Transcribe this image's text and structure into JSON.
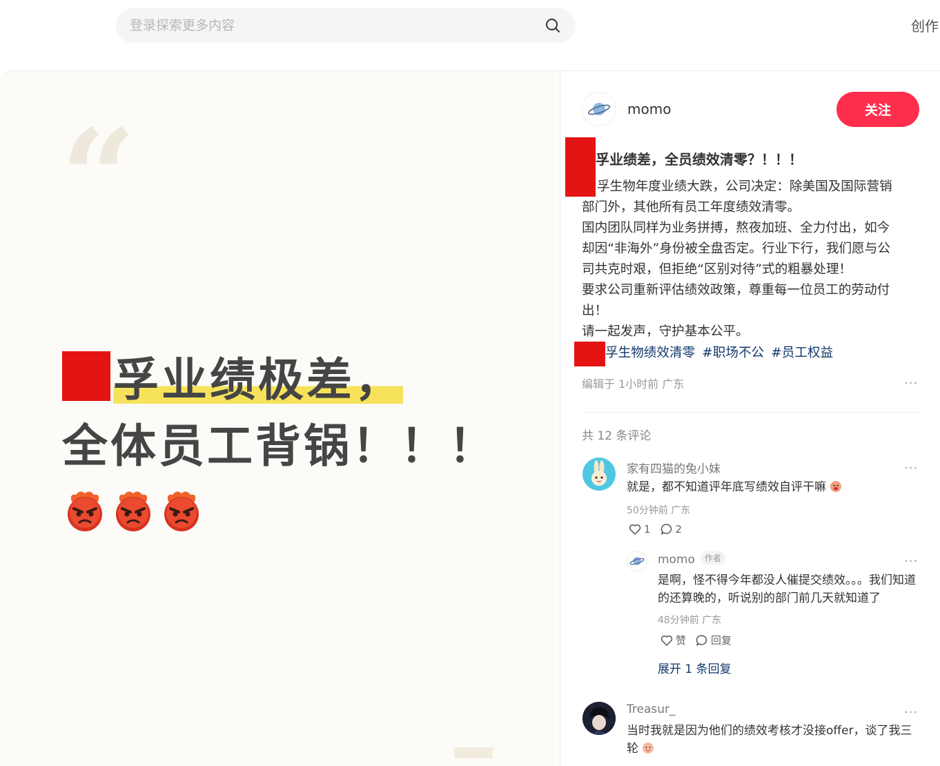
{
  "search": {
    "placeholder": "登录探索更多内容"
  },
  "header": {
    "create_label": "创作"
  },
  "media": {
    "headline_line1_rest": "孚业绩极差，",
    "headline_line2": "全体员工背锅！！！"
  },
  "author": {
    "name": "momo",
    "follow_label": "关注"
  },
  "post": {
    "title": "孚业绩差，全员绩效清零？！！！",
    "body_first": "孚生物年度业绩大跌，公司决定：除美国及国际营销",
    "body_lines": [
      "部门外，其他所有员工年度绩效清零。",
      "国内团队同样为业务拼搏，熬夜加班、全力付出，如今",
      "却因“非海外”身份被全盘否定。行业下行，我们愿与公",
      "司共克时艰，但拒绝“区别对待”式的粗暴处理！",
      "要求公司重新评估绩效政策，尊重每一位员工的劳动付",
      "出！",
      "请一起发声，守护基本公平。"
    ],
    "tags": [
      "孚生物绩效清零",
      "#职场不公",
      "#员工权益"
    ],
    "edit_meta": "编辑于 1小时前 广东"
  },
  "comments": {
    "count_label": "共 12 条评论",
    "items": [
      {
        "name": "家有四猫的兔小妹",
        "text": "就是，都不知道评年底写绩效自评干嘛",
        "meta": "50分钟前 广东",
        "likes": "1",
        "replies": "2"
      },
      {
        "name": "momo",
        "author_tag": "作者",
        "text": "是啊，怪不得今年都没人催提交绩效。。。我们知道的还算晚的，听说别的部门前几天就知道了",
        "meta": "48分钟前 广东",
        "like_label": "赞",
        "reply_label": "回复"
      },
      {
        "name": "Treasur_",
        "text": "当时我就是因为他们的绩效考核才没接offer，谈了我三轮"
      }
    ],
    "expand_label": "展开 1 条回复"
  },
  "more_label": "···"
}
